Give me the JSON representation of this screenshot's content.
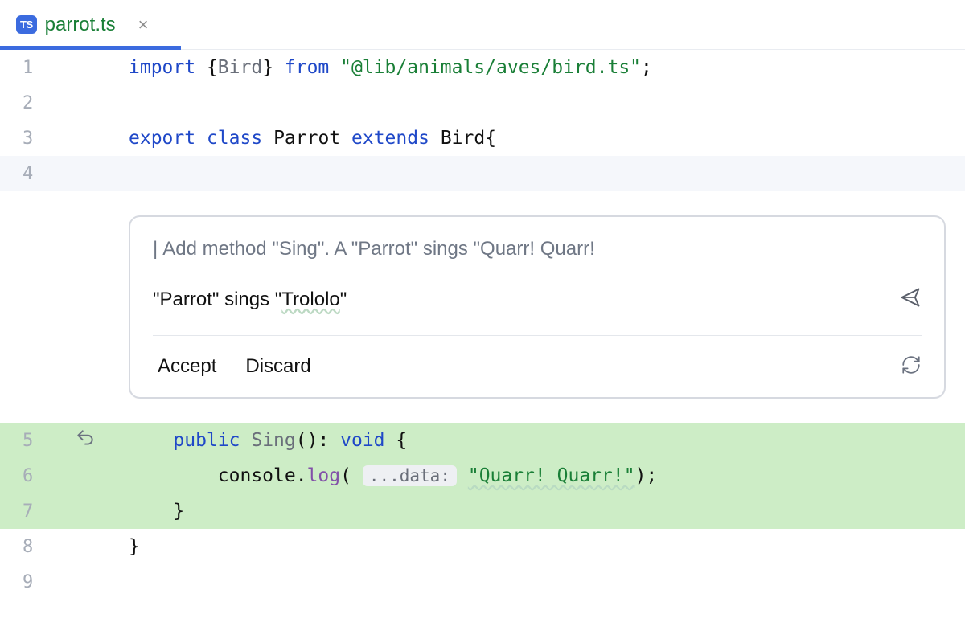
{
  "tab": {
    "badge": "TS",
    "filename": "parrot.ts"
  },
  "gutter": {
    "l1": "1",
    "l2": "2",
    "l3": "3",
    "l4": "4",
    "l5": "5",
    "l6": "6",
    "l7": "7",
    "l8": "8",
    "l9": "9"
  },
  "code": {
    "line1": {
      "kw_import": "import",
      "braces_l": " {",
      "type": "Bird",
      "braces_r": "} ",
      "kw_from": "from",
      "sp": " ",
      "str": "\"@lib/animals/aves/bird.ts\"",
      "semi": ";"
    },
    "line3": {
      "kw_export": "export",
      "sp1": " ",
      "kw_class": "class",
      "sp2": " ",
      "name": "Parrot",
      "sp3": " ",
      "kw_extends": "extends",
      "sp4": " ",
      "base": "Bird",
      "brace": "{"
    },
    "line5": {
      "indent": "    ",
      "kw_public": "public",
      "sp1": " ",
      "method": "Sing",
      "parens": "(): ",
      "kw_void": "void",
      "brace": " {"
    },
    "line6": {
      "indent": "        ",
      "obj": "console",
      "dot": ".",
      "fn": "log",
      "open": "( ",
      "hint": "...data:",
      "sp": " ",
      "str": "\"Quarr! Quarr!\"",
      "close": ");"
    },
    "line7": {
      "indent": "    ",
      "brace": "}"
    },
    "line8": {
      "brace": "}"
    }
  },
  "panel": {
    "instruction": "Add method \"Sing\". A \"Parrot\" sings \"Quarr! Quarr!",
    "input_prefix": "\"Parrot\" sings \"",
    "input_wavy": "Trololo",
    "input_suffix": "\"",
    "accept": "Accept",
    "discard": "Discard"
  }
}
